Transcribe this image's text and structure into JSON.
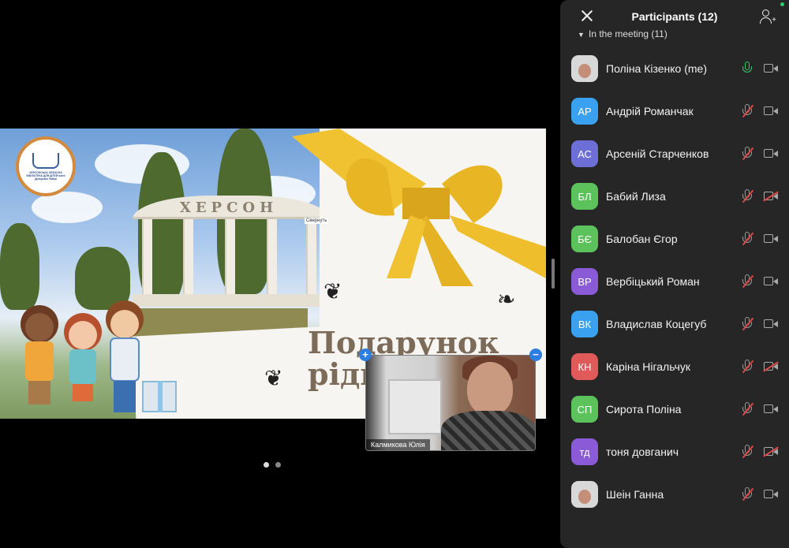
{
  "slide": {
    "arch_text": "ХЕРСОН",
    "title_line1": "Подарунок",
    "title_line2": "рідно",
    "logo_text": "ХЕРСОНСЬКА ОБЛАСНА БІБЛІОТЕКА ДЛЯ ДІТЕЙ імені Дніпрової Чайки",
    "label": "Свернуть",
    "page_count": 2,
    "active_page": 1
  },
  "video": {
    "name": "Калмикова Юлія",
    "expand_label": "+",
    "collapse_label": "−"
  },
  "panel": {
    "title": "Participants (12)",
    "section_label": "In the meeting (11)",
    "participants": [
      {
        "initials": "",
        "name": "Поліна Кізенко (me)",
        "color": "#d8d8d8",
        "photo": true,
        "mic_on": true,
        "cam_off": false
      },
      {
        "initials": "АР",
        "name": "Андрій Романчак",
        "color": "#3aa0f0",
        "photo": false,
        "mic_on": false,
        "cam_off": false
      },
      {
        "initials": "АС",
        "name": "Арсеній Старченков",
        "color": "#6e6fd6",
        "photo": false,
        "mic_on": false,
        "cam_off": false
      },
      {
        "initials": "БЛ",
        "name": "Бабий Лиза",
        "color": "#5cc35c",
        "photo": false,
        "mic_on": false,
        "cam_off": true
      },
      {
        "initials": "БЄ",
        "name": "Балобан Єгор",
        "color": "#5cc35c",
        "photo": false,
        "mic_on": false,
        "cam_off": false
      },
      {
        "initials": "ВР",
        "name": "Вербіцький Роман",
        "color": "#8b5ad6",
        "photo": false,
        "mic_on": false,
        "cam_off": false
      },
      {
        "initials": "ВК",
        "name": "Владислав Коцегуб",
        "color": "#3aa0f0",
        "photo": false,
        "mic_on": false,
        "cam_off": false
      },
      {
        "initials": "КН",
        "name": "Каріна Нігальчук",
        "color": "#e05a5a",
        "photo": false,
        "mic_on": false,
        "cam_off": true
      },
      {
        "initials": "СП",
        "name": "Сирота Поліна",
        "color": "#5cc35c",
        "photo": false,
        "mic_on": false,
        "cam_off": false
      },
      {
        "initials": "тд",
        "name": "тоня довганич",
        "color": "#8b5ad6",
        "photo": false,
        "mic_on": false,
        "cam_off": true
      },
      {
        "initials": "",
        "name": "Шеін Ганна",
        "color": "#d8d8d8",
        "photo": true,
        "mic_on": false,
        "cam_off": false
      }
    ]
  }
}
